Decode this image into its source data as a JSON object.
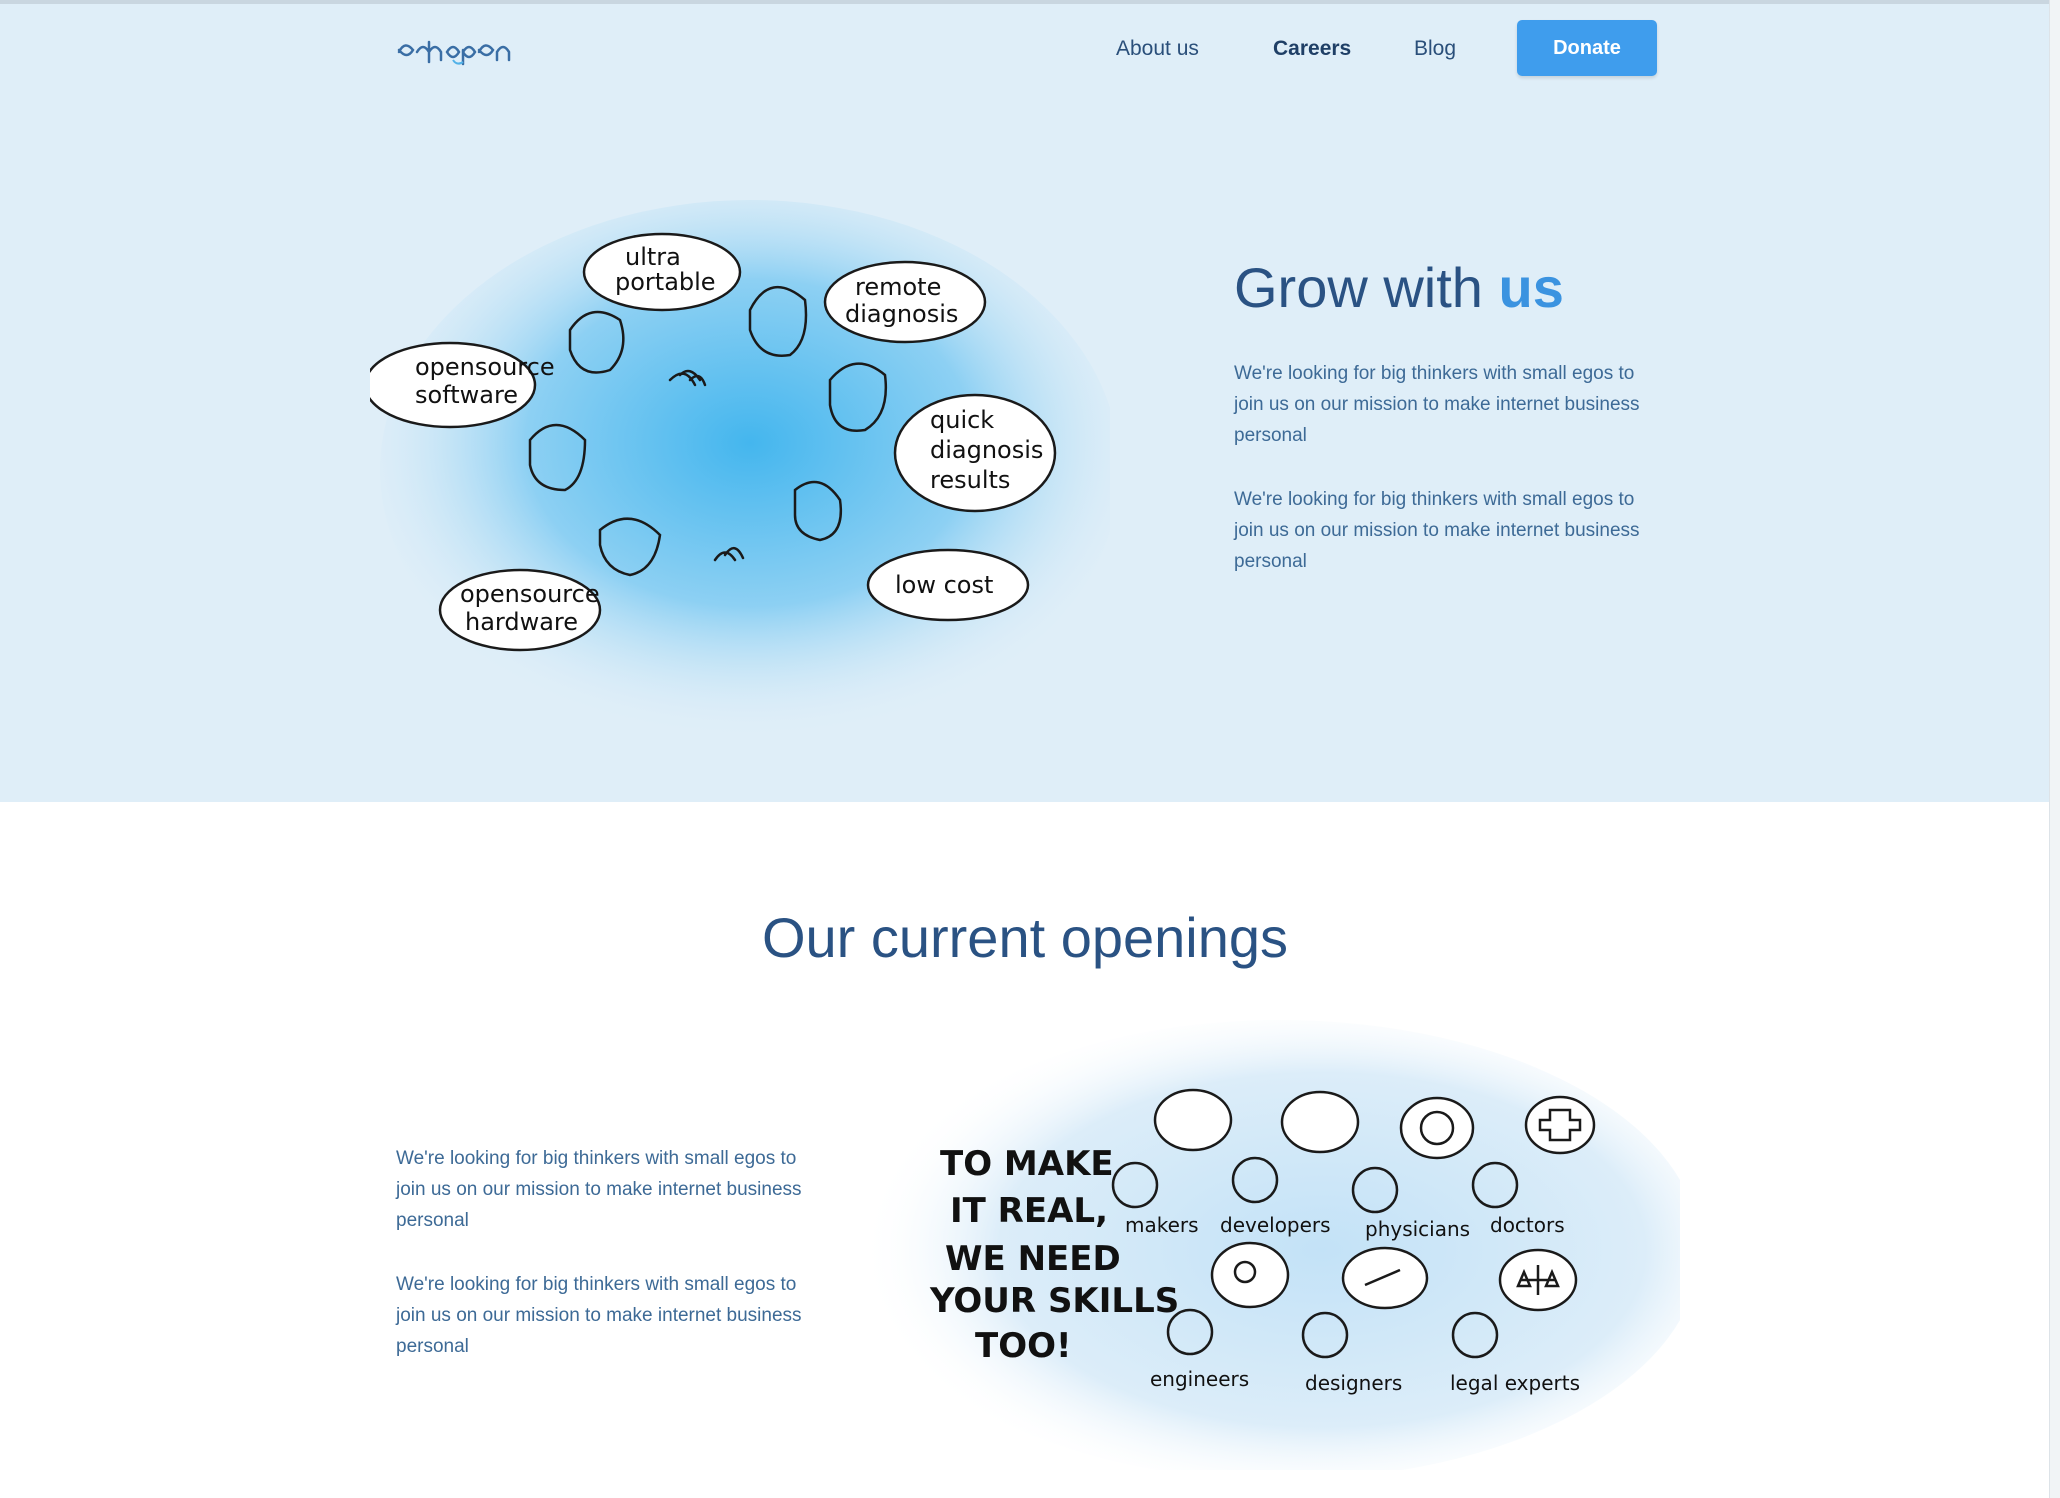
{
  "brand": {
    "logo_text": "echopen"
  },
  "nav": {
    "items": [
      {
        "label": "About us"
      },
      {
        "label": "Careers"
      },
      {
        "label": "Blog"
      }
    ],
    "donate_label": "Donate"
  },
  "hero": {
    "title_prefix": "Grow with ",
    "title_accent": "us",
    "paragraphs": [
      "We're looking for big thinkers with small egos to join us on our mission to make internet business personal",
      "We're looking for big thinkers with small egos to join us on our mission to make internet business personal"
    ],
    "illustration_bubbles": {
      "b1": "opensource",
      "b1b": "software",
      "b2": "ultra",
      "b2b": "portable",
      "b3": "remote",
      "b3b": "diagnosis",
      "b4": "quick",
      "b4b": "diagnosis",
      "b4c": "results",
      "b5": "low cost",
      "b6": "opensource",
      "b6b": "hardware"
    }
  },
  "openings": {
    "title": "Our current openings",
    "paragraphs": [
      "We're looking for big thinkers with small egos to join us on our mission to make internet business personal",
      "We're looking for big thinkers with small egos to join us on our mission to make internet business personal"
    ],
    "illustration": {
      "slogan_1": "TO MAKE",
      "slogan_2": "IT REAL,",
      "slogan_3": "WE NEED",
      "slogan_4": "YOUR SKILLS",
      "slogan_5": "TOO!",
      "roles": {
        "makers": "makers",
        "developers": "developers",
        "physicians": "physicians",
        "doctors": "doctors",
        "engineers": "engineers",
        "designers": "designers",
        "legal": "legal experts"
      }
    }
  },
  "colors": {
    "hero_bg": "#dfeef8",
    "accent": "#3f9ded",
    "text": "#2a5283"
  }
}
